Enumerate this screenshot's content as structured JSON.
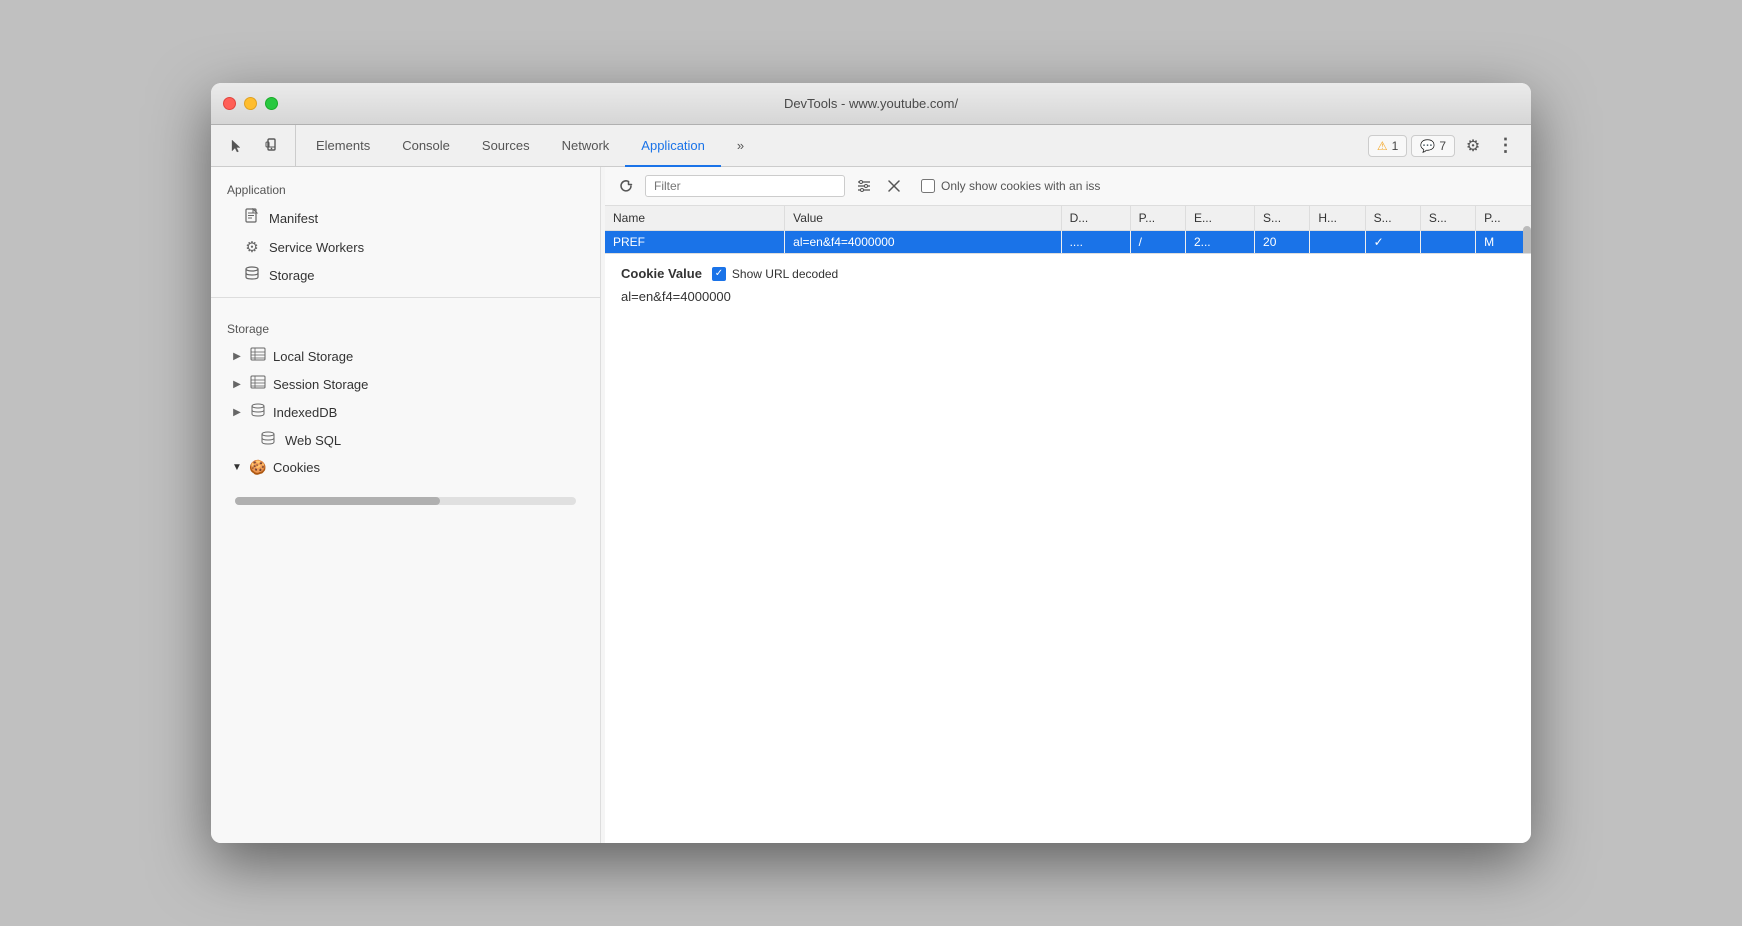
{
  "window": {
    "title": "DevTools - www.youtube.com/"
  },
  "toolbar": {
    "tabs": [
      {
        "id": "elements",
        "label": "Elements",
        "active": false
      },
      {
        "id": "console",
        "label": "Console",
        "active": false
      },
      {
        "id": "sources",
        "label": "Sources",
        "active": false
      },
      {
        "id": "network",
        "label": "Network",
        "active": false
      },
      {
        "id": "application",
        "label": "Application",
        "active": true
      },
      {
        "id": "more",
        "label": "»",
        "active": false
      }
    ],
    "warning_badge": "1",
    "chat_badge": "7",
    "more_tabs_label": "»"
  },
  "sidebar": {
    "app_section_title": "Application",
    "items_app": [
      {
        "id": "manifest",
        "label": "Manifest",
        "icon": "📄"
      },
      {
        "id": "service-workers",
        "label": "Service Workers",
        "icon": "⚙"
      },
      {
        "id": "storage-app",
        "label": "Storage",
        "icon": "🗄"
      }
    ],
    "storage_section_title": "Storage",
    "items_storage": [
      {
        "id": "local-storage",
        "label": "Local Storage",
        "icon": "▦",
        "expandable": true,
        "expanded": false
      },
      {
        "id": "session-storage",
        "label": "Session Storage",
        "icon": "▦",
        "expandable": true,
        "expanded": false
      },
      {
        "id": "indexeddb",
        "label": "IndexedDB",
        "icon": "🗄",
        "expandable": true,
        "expanded": false
      },
      {
        "id": "web-sql",
        "label": "Web SQL",
        "icon": "🗄",
        "expandable": false
      },
      {
        "id": "cookies",
        "label": "Cookies",
        "icon": "🍪",
        "expandable": true,
        "expanded": true
      }
    ]
  },
  "cookie_toolbar": {
    "filter_placeholder": "Filter",
    "filter_icon": "☰",
    "clear_icon": "✕",
    "checkbox_label": "Only show cookies with an iss"
  },
  "table": {
    "headers": [
      {
        "id": "name",
        "label": "Name"
      },
      {
        "id": "value",
        "label": "Value"
      },
      {
        "id": "domain",
        "label": "D..."
      },
      {
        "id": "path",
        "label": "P..."
      },
      {
        "id": "expires",
        "label": "E..."
      },
      {
        "id": "size",
        "label": "S..."
      },
      {
        "id": "httponly",
        "label": "H..."
      },
      {
        "id": "secure",
        "label": "S..."
      },
      {
        "id": "samesite",
        "label": "S..."
      },
      {
        "id": "priority",
        "label": "P..."
      }
    ],
    "rows": [
      {
        "selected": true,
        "name": "PREF",
        "value": "al=en&f4=4000000",
        "domain": "....",
        "path": "/",
        "expires": "2...",
        "size": "20",
        "httponly": "",
        "secure": "✓",
        "samesite": "",
        "priority": "M"
      }
    ]
  },
  "cookie_value": {
    "title": "Cookie Value",
    "checkbox_label": "Show URL decoded",
    "value": "al=en&f4=4000000"
  },
  "colors": {
    "accent_blue": "#1a73e8",
    "selected_row_bg": "#1a73e8",
    "warning": "#f5a623"
  }
}
